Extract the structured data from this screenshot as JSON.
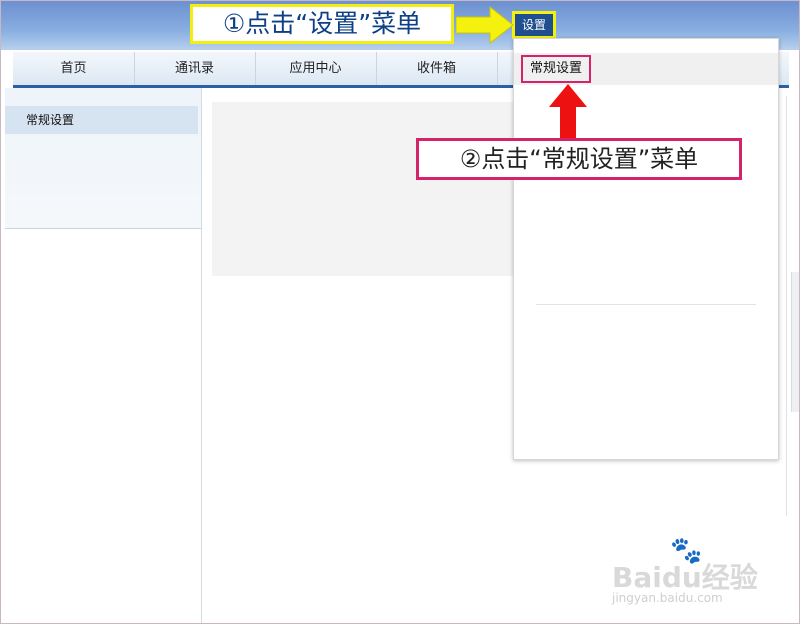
{
  "header": {
    "settings_label": "设置"
  },
  "nav": {
    "tabs": [
      "首页",
      "通讯录",
      "应用中心",
      "收件箱"
    ]
  },
  "sidebar": {
    "items": [
      {
        "label": "常规设置"
      }
    ]
  },
  "dropdown": {
    "items": [
      {
        "label": "常规设置"
      }
    ]
  },
  "annotations": {
    "step1": "①点击“设置”菜单",
    "step2": "②点击“常规设置”菜单"
  },
  "watermark": {
    "logo": "Baidu经验",
    "url": "jingyan.baidu.com"
  },
  "colors": {
    "header": "#6b8fd0",
    "nav_underline": "#2d5fa8",
    "step1_border": "#f2ee12",
    "step2_border": "#d4236b",
    "arrow_red": "#ee1111"
  }
}
